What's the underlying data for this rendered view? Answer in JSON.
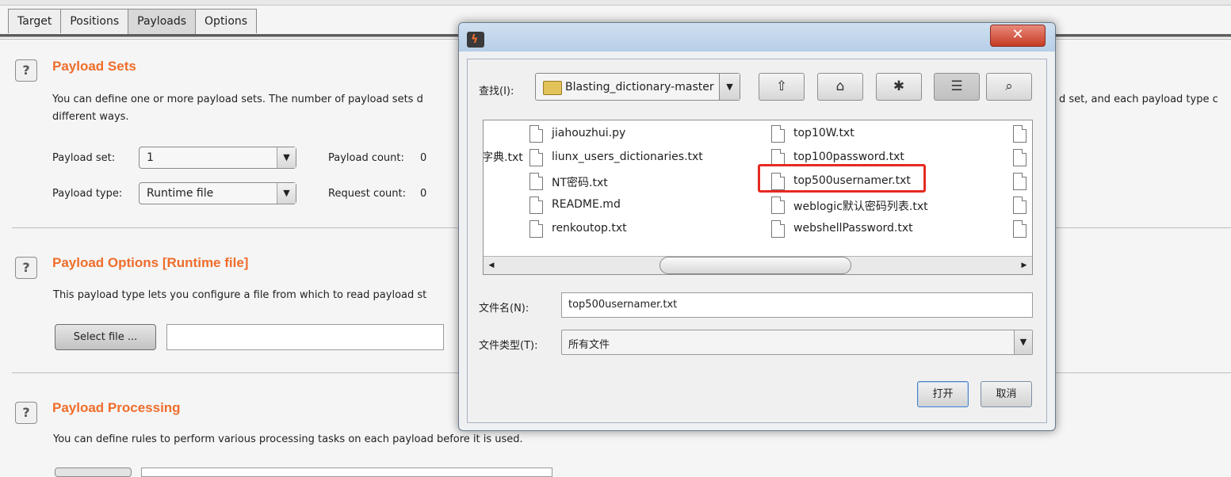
{
  "tabs": [
    {
      "label": "Target"
    },
    {
      "label": "Positions"
    },
    {
      "label": "Payloads"
    },
    {
      "label": "Options"
    }
  ],
  "active_tab": "Payloads",
  "help_glyph": "?",
  "sections": {
    "payload_sets": {
      "title": "Payload Sets",
      "description_line1": "You can define one or more payload sets. The number of payload sets d",
      "description_line1_tail": "d set, and each payload type c",
      "description_line2": "different ways.",
      "payload_set_label": "Payload set:",
      "payload_set_value": "1",
      "payload_type_label": "Payload type:",
      "payload_type_value": "Runtime file",
      "payload_count_label": "Payload count:",
      "payload_count_value": "0",
      "request_count_label": "Request count:",
      "request_count_value": "0"
    },
    "payload_options": {
      "title": "Payload Options [Runtime file]",
      "description": "This payload type lets you configure a file from which to read payload st",
      "select_file_label": "Select file ...",
      "file_path_value": ""
    },
    "payload_processing": {
      "title": "Payload Processing",
      "description": "You can define rules to perform various processing tasks on each payload before it is used."
    }
  },
  "dialog": {
    "close_glyph": "✕",
    "look_in_label": "查找(I):",
    "look_in_value": "Blasting_dictionary-master",
    "toolbar": {
      "up_icon": "up-folder-icon",
      "home_icon": "home-icon",
      "new_folder_icon": "new-folder-icon",
      "list_view_icon": "list-view-icon",
      "details_view_icon": "details-view-icon"
    },
    "partial_left_item": "字典.txt",
    "files_col1": [
      {
        "name": "jiahouzhui.py"
      },
      {
        "name": "liunx_users_dictionaries.txt"
      },
      {
        "name": "NT密码.txt"
      },
      {
        "name": "README.md"
      },
      {
        "name": "renkoutop.txt"
      }
    ],
    "files_col2": [
      {
        "name": "top10W.txt"
      },
      {
        "name": "top100password.txt"
      },
      {
        "name": "top500usernamer.txt",
        "selected": true
      },
      {
        "name": "weblogic默认密码列表.txt"
      },
      {
        "name": "webshellPassword.txt"
      }
    ],
    "file_name_label": "文件名(N):",
    "file_name_value": "top500usernamer.txt",
    "file_type_label": "文件类型(T):",
    "file_type_value": "所有文件",
    "open_label": "打开",
    "cancel_label": "取消",
    "highlight_color": "#e52a22"
  },
  "colors": {
    "section_title": "#ef6d2b",
    "background": "#f5f5f5"
  }
}
